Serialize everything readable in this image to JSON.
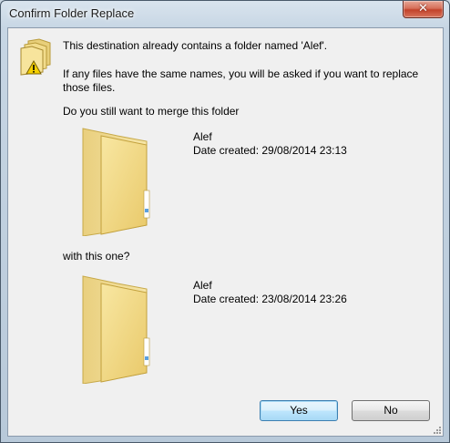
{
  "window": {
    "title": "Confirm Folder Replace",
    "close_icon": "close-icon"
  },
  "dialog": {
    "message_line1": "This destination already contains a folder named 'Alef'.",
    "message_line2a": "If any files have the same names, you will be asked if you want to replace",
    "message_line2b": "those files.",
    "question": "Do you still want to merge this folder",
    "with_this_one": "with this one?",
    "icon": "folder-warning-icon"
  },
  "source_folder": {
    "name": "Alef",
    "date_created": "Date created: 29/08/2014 23:13",
    "icon": "folder-icon"
  },
  "destination_folder": {
    "name": "Alef",
    "date_created": "Date created: 23/08/2014 23:26",
    "icon": "folder-icon"
  },
  "buttons": {
    "yes_label": "Yes",
    "no_label": "No"
  }
}
